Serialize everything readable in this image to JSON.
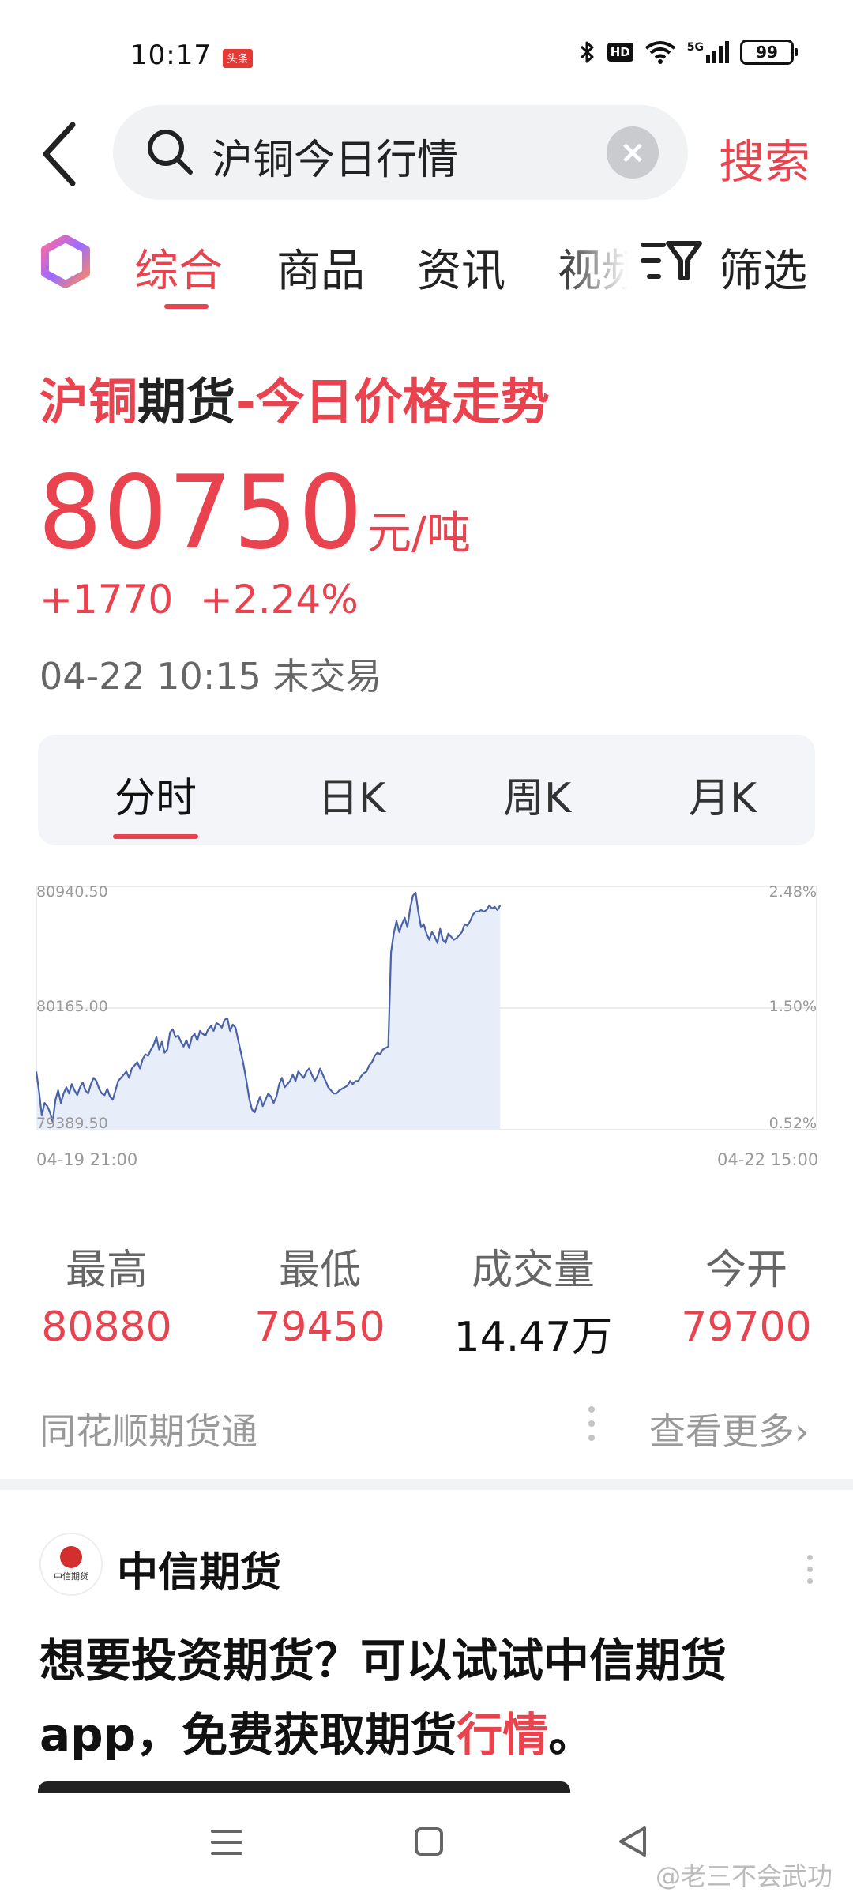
{
  "status_bar": {
    "time": "10:17",
    "app_badge": "头条",
    "network": "5G",
    "battery": "99"
  },
  "search": {
    "query": "沪铜今日行情",
    "submit_label": "搜索"
  },
  "tabs": {
    "items": [
      "综合",
      "商品",
      "资讯",
      "视频"
    ],
    "active": "综合",
    "filter_label": "筛选"
  },
  "quote": {
    "title_part1": "沪铜",
    "title_part2": "期货",
    "title_part3": "-今日价格走势",
    "price": "80750",
    "unit": "元/吨",
    "change": "+1770",
    "change_pct": "+2.24%",
    "timestamp": "04-22 10:15 未交易"
  },
  "period_tabs": [
    "分时",
    "日K",
    "周K",
    "月K"
  ],
  "chart_data": {
    "type": "area",
    "y_ticks_left": [
      "80940.50",
      "80165.00",
      "79389.50"
    ],
    "y_ticks_right": [
      "2.48%",
      "1.50%",
      "0.52%"
    ],
    "ylim": [
      79389.5,
      80940.5
    ],
    "x_start_label": "04-19 21:00",
    "x_end_label": "04-22 15:00",
    "grid": true,
    "series": [
      {
        "values": [
          79760,
          79630,
          79480,
          79560,
          79540,
          79500,
          79440,
          79580,
          79640,
          79560,
          79620,
          79660,
          79620,
          79680,
          79640,
          79610,
          79660,
          79690,
          79640,
          79620,
          79680,
          79720,
          79700,
          79650,
          79620,
          79610,
          79650,
          79600,
          79580,
          79640,
          79700,
          79720,
          79740,
          79760,
          79720,
          79780,
          79800,
          79820,
          79780,
          79840,
          79870,
          79860,
          79900,
          79930,
          79980,
          79900,
          79950,
          79880,
          79900,
          80010,
          80030,
          79980,
          79990,
          79950,
          79920,
          79960,
          79910,
          79980,
          80000,
          79960,
          80020,
          80000,
          79990,
          80030,
          80050,
          80020,
          80070,
          80060,
          80040,
          80090,
          80100,
          80020,
          80060,
          80040,
          79960,
          79880,
          79800,
          79700,
          79590,
          79520,
          79500,
          79550,
          79600,
          79540,
          79580,
          79620,
          79600,
          79560,
          79600,
          79680,
          79720,
          79660,
          79680,
          79700,
          79740,
          79700,
          79760,
          79740,
          79720,
          79760,
          79780,
          79740,
          79700,
          79730,
          79780,
          79740,
          79700,
          79660,
          79640,
          79620,
          79620,
          79640,
          79650,
          79660,
          79670,
          79700,
          79680,
          79700,
          79700,
          79730,
          79750,
          79760,
          79800,
          79820,
          79860,
          79880,
          79870,
          79900,
          79910,
          79920,
          80520,
          80640,
          80720,
          80650,
          80700,
          80740,
          80680,
          80800,
          80880,
          80900,
          80780,
          80680,
          80700,
          80640,
          80600,
          80650,
          80620,
          80580,
          80670,
          80600,
          80580,
          80640,
          80620,
          80600,
          80610,
          80630,
          80650,
          80700,
          80690,
          80720,
          80760,
          80780,
          80780,
          80790,
          80780,
          80790,
          80820,
          80800,
          80810,
          80790,
          80820
        ]
      }
    ]
  },
  "stats": [
    {
      "label": "最高",
      "value": "80880"
    },
    {
      "label": "最低",
      "value": "79450"
    },
    {
      "label": "成交量",
      "value": "14.47万"
    },
    {
      "label": "今开",
      "value": "79700"
    }
  ],
  "source": {
    "name": "同花顺期货通",
    "see_more": "查看更多›"
  },
  "ad": {
    "brand": "中信期货",
    "logo_text": "中信期货",
    "text_main": "想要投资期货？可以试试中信期货app，免费获取期货",
    "text_highlight": "行情",
    "text_end": "。"
  },
  "watermark": "@老三不会武功"
}
